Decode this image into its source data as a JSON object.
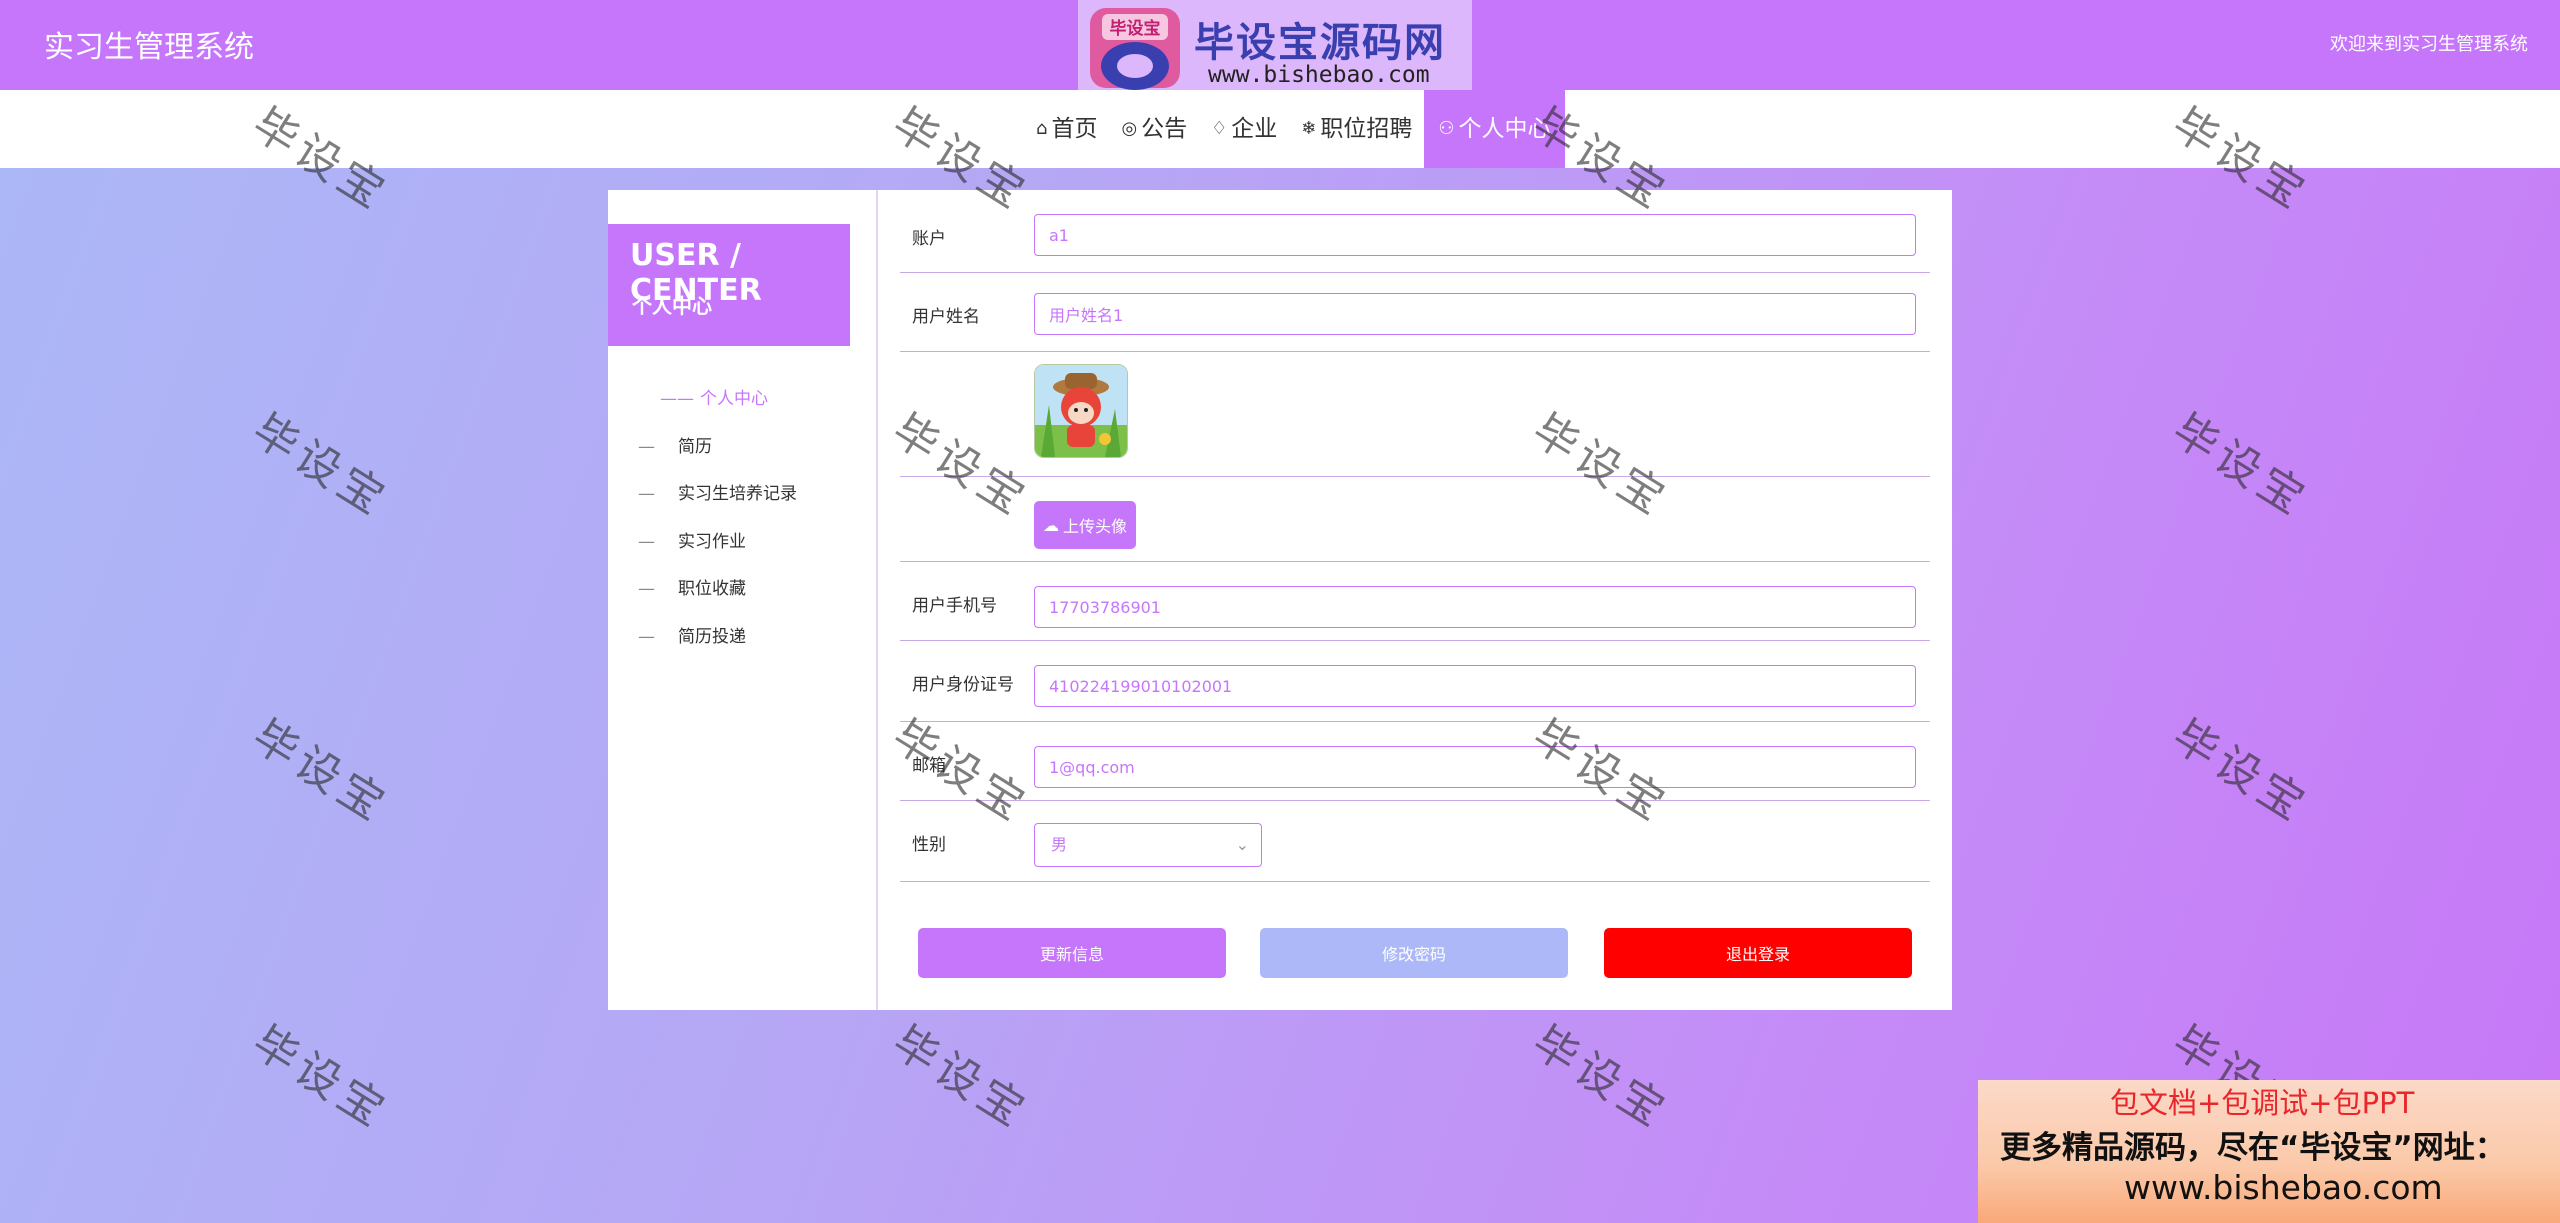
{
  "header": {
    "system_title": "实习生管理系统",
    "welcome": "欢迎来到实习生管理系统",
    "logo_title": "毕设宝源码网",
    "logo_badge": "毕设宝",
    "logo_url": "www.bishebao.com"
  },
  "nav": {
    "items": [
      {
        "icon": "⌂",
        "label": "首页"
      },
      {
        "icon": "◎",
        "label": "公告"
      },
      {
        "icon": "♢",
        "label": "企业"
      },
      {
        "icon": "❄",
        "label": "职位招聘"
      },
      {
        "icon": "⚇",
        "label": "个人中心"
      }
    ],
    "active_index": 4
  },
  "watermark": "毕设宝",
  "sidebar": {
    "title_en": "USER / CENTER",
    "title_cn": "个人中心",
    "items": [
      {
        "dash": "——",
        "label": "个人中心"
      },
      {
        "dash": "—",
        "label": "简历"
      },
      {
        "dash": "—",
        "label": "实习生培养记录"
      },
      {
        "dash": "—",
        "label": "实习作业"
      },
      {
        "dash": "—",
        "label": "职位收藏"
      },
      {
        "dash": "—",
        "label": "简历投递"
      }
    ]
  },
  "form": {
    "account": {
      "label": "账户",
      "value": "a1"
    },
    "name": {
      "label": "用户姓名",
      "value": "用户姓名1"
    },
    "upload_label": "上传头像",
    "phone": {
      "label": "用户手机号",
      "value": "17703786901"
    },
    "id_card": {
      "label": "用户身份证号",
      "value": "410224199010102001"
    },
    "email": {
      "label": "邮箱",
      "value": "1@qq.com"
    },
    "gender": {
      "label": "性别",
      "value": "男"
    }
  },
  "buttons": {
    "update": "更新信息",
    "change_password": "修改密码",
    "logout": "退出登录"
  },
  "colors": {
    "primary": "#c676fb",
    "secondary": "#acb8f7",
    "danger": "#ff0000"
  },
  "promo": {
    "line1": "包文档+包调试+包PPT",
    "line2": "更多精品源码，尽在“毕设宝”网址：",
    "line3": "www.bishebao.com"
  }
}
